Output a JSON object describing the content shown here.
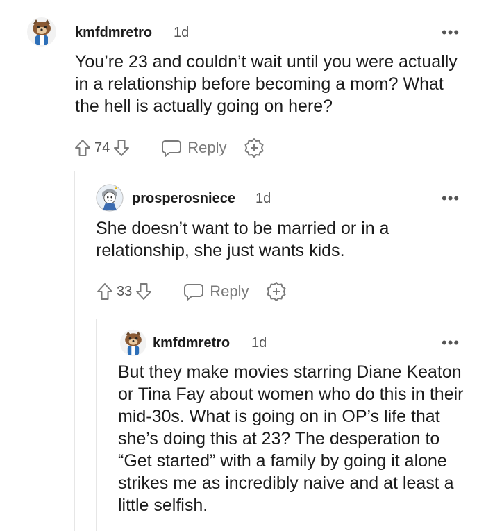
{
  "comments": [
    {
      "username": "kmfdmretro",
      "age": "1d",
      "more": "•••",
      "text": "You’re 23 and couldn’t wait until you were actually in a relationship before becoming a mom? What the hell is actually going on here?",
      "votes": "74",
      "reply_label": "Reply"
    },
    {
      "username": "prosperosniece",
      "age": "1d",
      "more": "•••",
      "text": "She doesn’t want to be married or in a relationship, she just wants kids.",
      "votes": "33",
      "reply_label": "Reply"
    },
    {
      "username": "kmfdmretro",
      "age": "1d",
      "more": "•••",
      "text": "But they make movies starring Diane Keaton or Tina Fay about women who do this in their mid-30s. What is going on in OP’s life that she’s doing this at 23? The desperation to “Get started” with a family by going it alone strikes me as incredibly naive and at least a little selfish."
    }
  ]
}
